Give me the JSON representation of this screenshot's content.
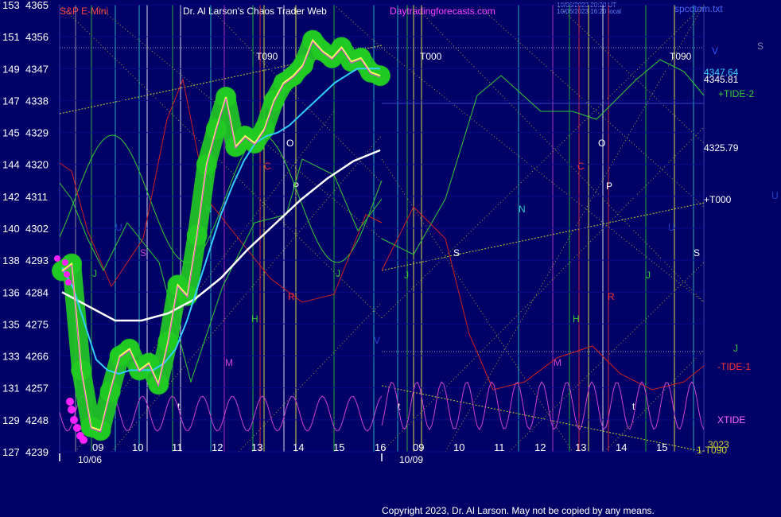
{
  "header": {
    "symbol": "S&P E-Mini",
    "title": "Dr. Al Larson's Chaos Trader Web",
    "site": "Daytradingforecasts.com",
    "stamp1": "10/06/2023 20:20 UT",
    "stamp2": "10/06/2023 16:20 local",
    "file": "spcctom.txt"
  },
  "colors": {
    "background": "#000066",
    "price": "#ffff66",
    "ma_fast": "#33ccff",
    "ma_slow": "#ffffff",
    "glow": "#22cc22",
    "tide_pos": "#33cc33",
    "tide_neg": "#cc2222",
    "xtide": "#cc44cc",
    "trend": "#cccc33"
  },
  "right_labels": {
    "v1": "4347.64",
    "v2": "4345.81",
    "tide2": "+TIDE-2",
    "v3": "4325.79",
    "t000": "+T000",
    "u": "U",
    "s": "S",
    "j": "J",
    "tide1": "-TIDE-1",
    "xtide": "XTIDE",
    "bottom": "1-T090",
    "v": "V",
    "bottom2": "3023"
  },
  "chart_data": {
    "type": "line",
    "title": "S&P E-Mini",
    "y_left_scale": [
      "153",
      "151",
      "149",
      "147",
      "145",
      "144",
      "142",
      "140",
      "138",
      "136",
      "135",
      "133",
      "131",
      "129",
      "127"
    ],
    "y_right_scale": [
      4365,
      4356,
      4347,
      4338,
      4329,
      4320,
      4311,
      4302,
      4293,
      4284,
      4275,
      4266,
      4257,
      4248,
      4239
    ],
    "ylim": [
      4239,
      4365
    ],
    "x_hours": [
      "09",
      "10",
      "11",
      "12",
      "13",
      "14",
      "15",
      "16",
      "09",
      "10",
      "11",
      "12",
      "13",
      "14",
      "15"
    ],
    "dates": [
      "10/06",
      "10/09"
    ],
    "markers": [
      "T090",
      "T000",
      "T090"
    ],
    "price_series": {
      "name": "",
      "values": [
        4290,
        4292,
        4262,
        4246,
        4245,
        4256,
        4266,
        4268,
        4262,
        4264,
        4258,
        4270,
        4286,
        4283,
        4300,
        4320,
        4330,
        4339,
        4325,
        4328,
        4326,
        4330,
        4338,
        4343,
        4345,
        4348,
        4355,
        4352,
        4350,
        4353,
        4349,
        4350,
        4346,
        4345
      ]
    },
    "ma_fast": {
      "name": "",
      "values": [
        4291,
        4285,
        4275,
        4265,
        4262,
        4261,
        4262,
        4262,
        4262,
        4264,
        4268,
        4276,
        4286,
        4296,
        4306,
        4314,
        4321,
        4326,
        4328,
        4329,
        4331,
        4334,
        4337,
        4340,
        4343,
        4345,
        4347,
        4347,
        4347
      ]
    },
    "ma_slow": {
      "name": "",
      "values": [
        4284,
        4280,
        4276,
        4276,
        4278,
        4282,
        4288,
        4296,
        4303,
        4310,
        4316,
        4321,
        4324
      ]
    }
  },
  "copyright": "Copyright 2023, Dr. Al Larson. May not be copied by any means."
}
